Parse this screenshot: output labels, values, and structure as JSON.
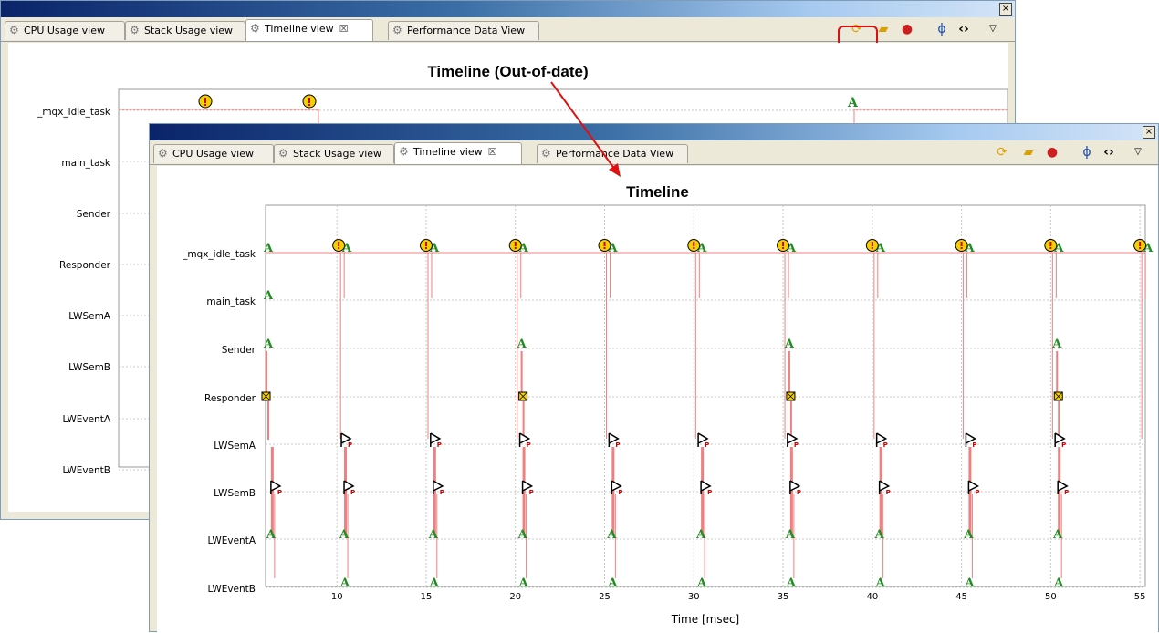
{
  "tabs": [
    "CPU Usage view",
    "Stack Usage view",
    "Timeline view",
    "Performance Data View"
  ],
  "close_glyph": "☒",
  "window_close": "×",
  "back": {
    "title": "Timeline (Out-of-date)",
    "rows": [
      "_mqx_idle_task",
      "main_task",
      "Sender",
      "Responder",
      "LWSemA",
      "LWSemB",
      "LWEventA",
      "LWEventB"
    ]
  },
  "front": {
    "title": "Timeline",
    "rows": [
      "_mqx_idle_task",
      "main_task",
      "Sender",
      "Responder",
      "LWSemA",
      "LWSemB",
      "LWEventA",
      "LWEventB"
    ],
    "x_ticks": [
      "10",
      "15",
      "20",
      "25",
      "30",
      "35",
      "40",
      "45",
      "50",
      "55"
    ],
    "x_label": "Time [msec]"
  },
  "chart_data": {
    "type": "timeline",
    "title": "Timeline",
    "xlabel": "Time [msec]",
    "x_ticks": [
      10,
      15,
      20,
      25,
      30,
      35,
      40,
      45,
      50,
      55
    ],
    "xlim": [
      6,
      55.3
    ],
    "rows": [
      "_mqx_idle_task",
      "main_task",
      "Sender",
      "Responder",
      "LWSemA",
      "LWSemB",
      "LWEventA",
      "LWEventB"
    ],
    "idle_interrupts_ms": [
      10.1,
      15.0,
      20.0,
      25.0,
      30.0,
      35.0,
      40.0,
      45.0,
      50.0,
      55.0
    ],
    "sender_responder_ms": [
      6.0,
      20.3,
      35.3,
      50.3
    ],
    "lwsemb_post_ms": [
      6.3,
      10.4,
      15.4,
      20.4,
      25.4,
      30.4,
      35.4,
      40.4,
      45.4,
      50.4
    ],
    "colors": {
      "trace": "#f08080",
      "event": "#228b22",
      "marker": "#f5d000"
    }
  },
  "colors": {
    "highlight": "#e01010",
    "arrow": "#e01010"
  }
}
